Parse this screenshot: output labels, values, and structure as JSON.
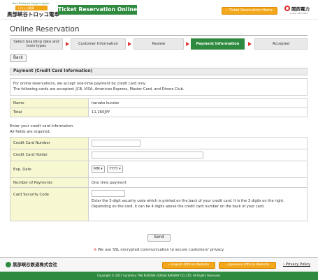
{
  "header": {
    "logo_tagline": "Kuro Preferred Gorge in Japan",
    "logo_mark": "トロッコ電車",
    "logo_name": "黒部峡谷トロッコ電車",
    "site_title": "Ticket Reservation Online",
    "home_button": "› Ticket Reservation Home",
    "partner_name": "関西電力",
    "partner_sub": "power with heart"
  },
  "page_title": "Online Reservation",
  "steps": [
    {
      "line1": "Select boarding date and",
      "line2": "train types",
      "active": false
    },
    {
      "line1": "Customer Information",
      "line2": "",
      "active": false
    },
    {
      "line1": "Review",
      "line2": "",
      "active": false
    },
    {
      "line1": "Payment Information",
      "line2": "",
      "active": true
    },
    {
      "line1": "Accepted",
      "line2": "",
      "active": false
    }
  ],
  "back_button": "Back",
  "section_title": "Payment (Credit Card Information)",
  "info": {
    "line1": "For online reservations, we accept one-time payment by credit card only.",
    "line2": "The following cards are accepted: JCB, VISA, American Express, Master Card, and Diners Club."
  },
  "summary": {
    "name_label": "Name",
    "name_value": "hanako kurobe",
    "total_label": "Total",
    "total_value": "11,260JPY"
  },
  "instructions": {
    "line1": "Enter your credit card information.",
    "line2": "All fields are required."
  },
  "form": {
    "card_number_label": "Credit Card Number",
    "card_number_value": "",
    "card_holder_label": "Credit Card Holder",
    "card_holder_value": "",
    "exp_label": "Exp. Date",
    "exp_month": "MM",
    "exp_year": "YYYY",
    "payments_label": "Number of Payments",
    "payments_value": "One time payment",
    "code_label": "Card Security Code",
    "code_value": "",
    "code_desc1": "Enter the 3-digit security code which is printed on the back of your credit card. It is the 3 digits on the right.",
    "code_desc2": "Depending on the card, it can be 4 digits above the credit card number on the back of your card."
  },
  "send_button": "Send",
  "ssl_notice": {
    "mark": "※",
    "text": " We use SSL encrypted communication to secure customers' privacy."
  },
  "footer": {
    "company": "黒部峡谷鉄道株式会社",
    "english_site": "› English Official Website",
    "japanese_site": "› Japanese Official Website",
    "privacy": "› Privacy Policy",
    "copyright": "Copyright © 2017 kurotetsu THE KUROBE GORGE RAILWAY CO.,LTD. All Rights Reserved."
  },
  "colors": {
    "brand_green": "#2e8a3e",
    "accent_orange": "#f3a81b",
    "step_arrow_red": "#e13232",
    "label_cell_yellow": "#f7f7d2"
  }
}
